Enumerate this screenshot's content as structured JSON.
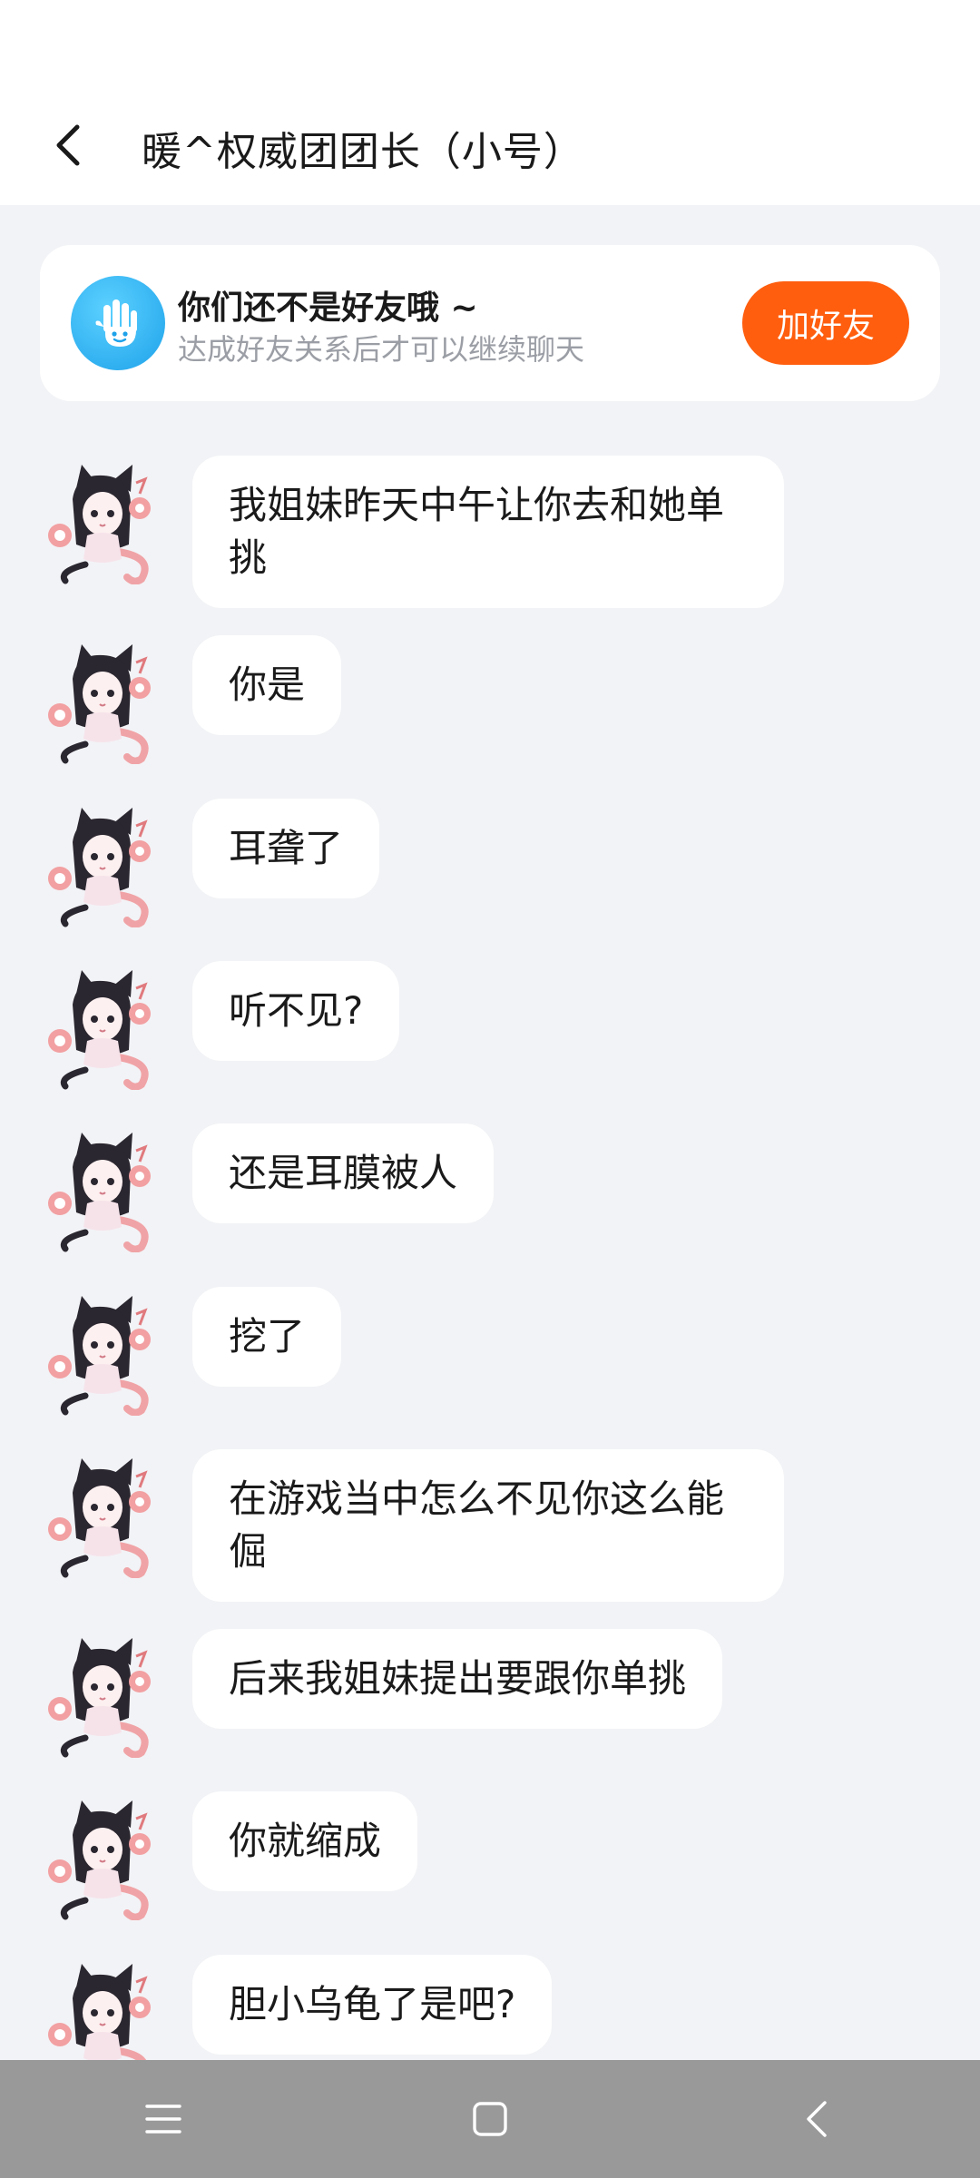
{
  "header": {
    "title": "暖^权威团团长（小号）"
  },
  "friend_card": {
    "title": "你们还不是好友哦 ~",
    "subtitle": "达成好友关系后才可以继续聊天",
    "add_button": "加好友"
  },
  "colors": {
    "accent": "#ff5e0e",
    "hand_icon": "#1ea2ea"
  },
  "messages": [
    {
      "text": "我姐妹昨天中午让你去和她单挑"
    },
    {
      "text": "你是"
    },
    {
      "text": "耳聋了"
    },
    {
      "text": "听不见?"
    },
    {
      "text": "还是耳膜被人"
    },
    {
      "text": "挖了"
    },
    {
      "text": "在游戏当中怎么不见你这么能倔"
    },
    {
      "text": "后来我姐妹提出要跟你单挑"
    },
    {
      "text": "你就缩成"
    },
    {
      "text": "胆小乌龟了是吧?"
    }
  ],
  "nav": {
    "icons": [
      "menu-icon",
      "home-icon",
      "back-icon"
    ]
  }
}
